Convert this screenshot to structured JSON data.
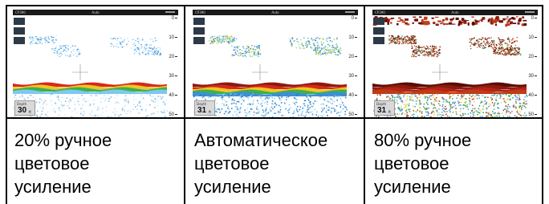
{
  "panels": [
    {
      "screen": {
        "title_left": "CP390",
        "title_center": "Auto",
        "depth_label": "Depth",
        "depth_value": "30",
        "depth_unit": "ft",
        "scale_ticks": [
          "0",
          "10",
          "20",
          "30",
          "40",
          "50"
        ],
        "gain_level": 0.2
      },
      "caption": [
        "20%  ручное",
        "цветовое",
        "усиление"
      ]
    },
    {
      "screen": {
        "title_left": "CP390",
        "title_center": "Auto",
        "depth_label": "Depth",
        "depth_value": "31",
        "depth_unit": "ft",
        "scale_ticks": [
          "0",
          "10",
          "20",
          "30",
          "40",
          "50"
        ],
        "gain_level": 0.5
      },
      "caption": [
        "Автоматическое",
        "цветовое",
        "усиление"
      ]
    },
    {
      "screen": {
        "title_left": "CP390",
        "title_center": "Auto",
        "depth_label": "Depth",
        "depth_value": "31",
        "depth_unit": "ft",
        "scale_ticks": [
          "0",
          "10",
          "20",
          "30",
          "40",
          "50"
        ],
        "gain_level": 0.8
      },
      "caption": [
        "80%  ручное",
        "цветовое",
        "усиление"
      ]
    }
  ]
}
